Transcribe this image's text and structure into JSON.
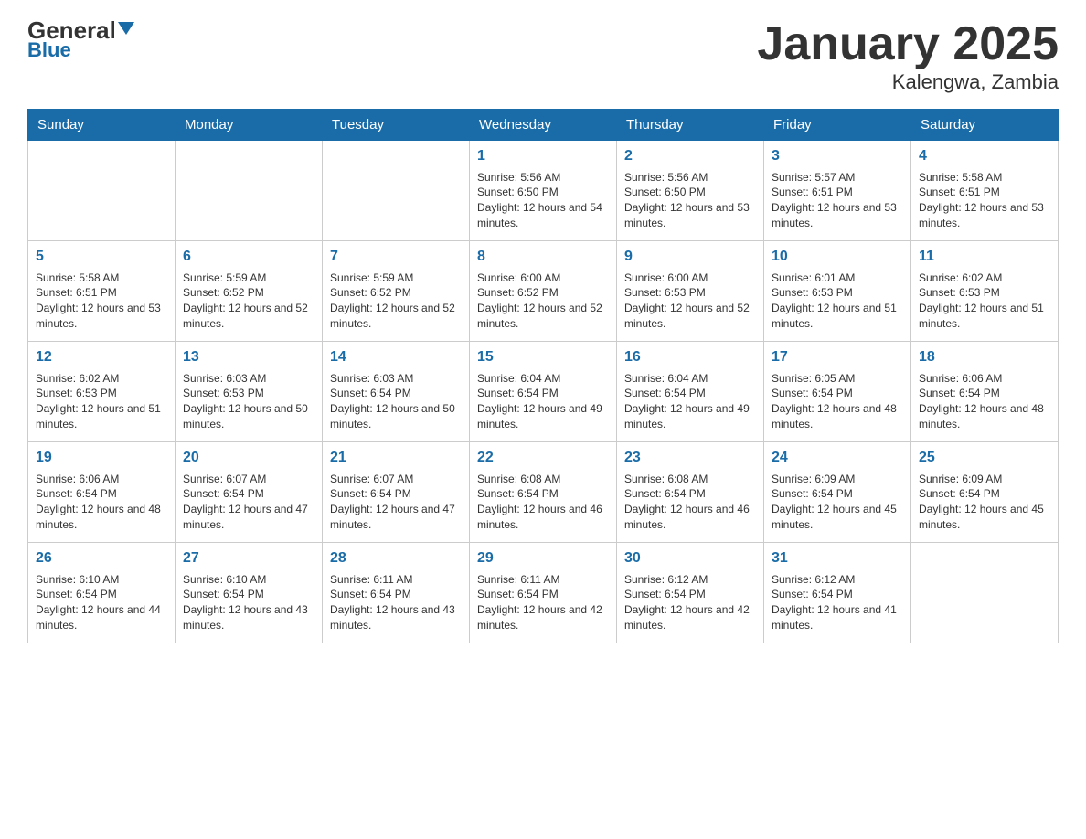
{
  "header": {
    "logo_main": "General",
    "logo_sub": "Blue",
    "title": "January 2025",
    "subtitle": "Kalengwa, Zambia"
  },
  "days_of_week": [
    "Sunday",
    "Monday",
    "Tuesday",
    "Wednesday",
    "Thursday",
    "Friday",
    "Saturday"
  ],
  "weeks": [
    [
      {
        "day": "",
        "info": ""
      },
      {
        "day": "",
        "info": ""
      },
      {
        "day": "",
        "info": ""
      },
      {
        "day": "1",
        "info": "Sunrise: 5:56 AM\nSunset: 6:50 PM\nDaylight: 12 hours and 54 minutes."
      },
      {
        "day": "2",
        "info": "Sunrise: 5:56 AM\nSunset: 6:50 PM\nDaylight: 12 hours and 53 minutes."
      },
      {
        "day": "3",
        "info": "Sunrise: 5:57 AM\nSunset: 6:51 PM\nDaylight: 12 hours and 53 minutes."
      },
      {
        "day": "4",
        "info": "Sunrise: 5:58 AM\nSunset: 6:51 PM\nDaylight: 12 hours and 53 minutes."
      }
    ],
    [
      {
        "day": "5",
        "info": "Sunrise: 5:58 AM\nSunset: 6:51 PM\nDaylight: 12 hours and 53 minutes."
      },
      {
        "day": "6",
        "info": "Sunrise: 5:59 AM\nSunset: 6:52 PM\nDaylight: 12 hours and 52 minutes."
      },
      {
        "day": "7",
        "info": "Sunrise: 5:59 AM\nSunset: 6:52 PM\nDaylight: 12 hours and 52 minutes."
      },
      {
        "day": "8",
        "info": "Sunrise: 6:00 AM\nSunset: 6:52 PM\nDaylight: 12 hours and 52 minutes."
      },
      {
        "day": "9",
        "info": "Sunrise: 6:00 AM\nSunset: 6:53 PM\nDaylight: 12 hours and 52 minutes."
      },
      {
        "day": "10",
        "info": "Sunrise: 6:01 AM\nSunset: 6:53 PM\nDaylight: 12 hours and 51 minutes."
      },
      {
        "day": "11",
        "info": "Sunrise: 6:02 AM\nSunset: 6:53 PM\nDaylight: 12 hours and 51 minutes."
      }
    ],
    [
      {
        "day": "12",
        "info": "Sunrise: 6:02 AM\nSunset: 6:53 PM\nDaylight: 12 hours and 51 minutes."
      },
      {
        "day": "13",
        "info": "Sunrise: 6:03 AM\nSunset: 6:53 PM\nDaylight: 12 hours and 50 minutes."
      },
      {
        "day": "14",
        "info": "Sunrise: 6:03 AM\nSunset: 6:54 PM\nDaylight: 12 hours and 50 minutes."
      },
      {
        "day": "15",
        "info": "Sunrise: 6:04 AM\nSunset: 6:54 PM\nDaylight: 12 hours and 49 minutes."
      },
      {
        "day": "16",
        "info": "Sunrise: 6:04 AM\nSunset: 6:54 PM\nDaylight: 12 hours and 49 minutes."
      },
      {
        "day": "17",
        "info": "Sunrise: 6:05 AM\nSunset: 6:54 PM\nDaylight: 12 hours and 48 minutes."
      },
      {
        "day": "18",
        "info": "Sunrise: 6:06 AM\nSunset: 6:54 PM\nDaylight: 12 hours and 48 minutes."
      }
    ],
    [
      {
        "day": "19",
        "info": "Sunrise: 6:06 AM\nSunset: 6:54 PM\nDaylight: 12 hours and 48 minutes."
      },
      {
        "day": "20",
        "info": "Sunrise: 6:07 AM\nSunset: 6:54 PM\nDaylight: 12 hours and 47 minutes."
      },
      {
        "day": "21",
        "info": "Sunrise: 6:07 AM\nSunset: 6:54 PM\nDaylight: 12 hours and 47 minutes."
      },
      {
        "day": "22",
        "info": "Sunrise: 6:08 AM\nSunset: 6:54 PM\nDaylight: 12 hours and 46 minutes."
      },
      {
        "day": "23",
        "info": "Sunrise: 6:08 AM\nSunset: 6:54 PM\nDaylight: 12 hours and 46 minutes."
      },
      {
        "day": "24",
        "info": "Sunrise: 6:09 AM\nSunset: 6:54 PM\nDaylight: 12 hours and 45 minutes."
      },
      {
        "day": "25",
        "info": "Sunrise: 6:09 AM\nSunset: 6:54 PM\nDaylight: 12 hours and 45 minutes."
      }
    ],
    [
      {
        "day": "26",
        "info": "Sunrise: 6:10 AM\nSunset: 6:54 PM\nDaylight: 12 hours and 44 minutes."
      },
      {
        "day": "27",
        "info": "Sunrise: 6:10 AM\nSunset: 6:54 PM\nDaylight: 12 hours and 43 minutes."
      },
      {
        "day": "28",
        "info": "Sunrise: 6:11 AM\nSunset: 6:54 PM\nDaylight: 12 hours and 43 minutes."
      },
      {
        "day": "29",
        "info": "Sunrise: 6:11 AM\nSunset: 6:54 PM\nDaylight: 12 hours and 42 minutes."
      },
      {
        "day": "30",
        "info": "Sunrise: 6:12 AM\nSunset: 6:54 PM\nDaylight: 12 hours and 42 minutes."
      },
      {
        "day": "31",
        "info": "Sunrise: 6:12 AM\nSunset: 6:54 PM\nDaylight: 12 hours and 41 minutes."
      },
      {
        "day": "",
        "info": ""
      }
    ]
  ]
}
